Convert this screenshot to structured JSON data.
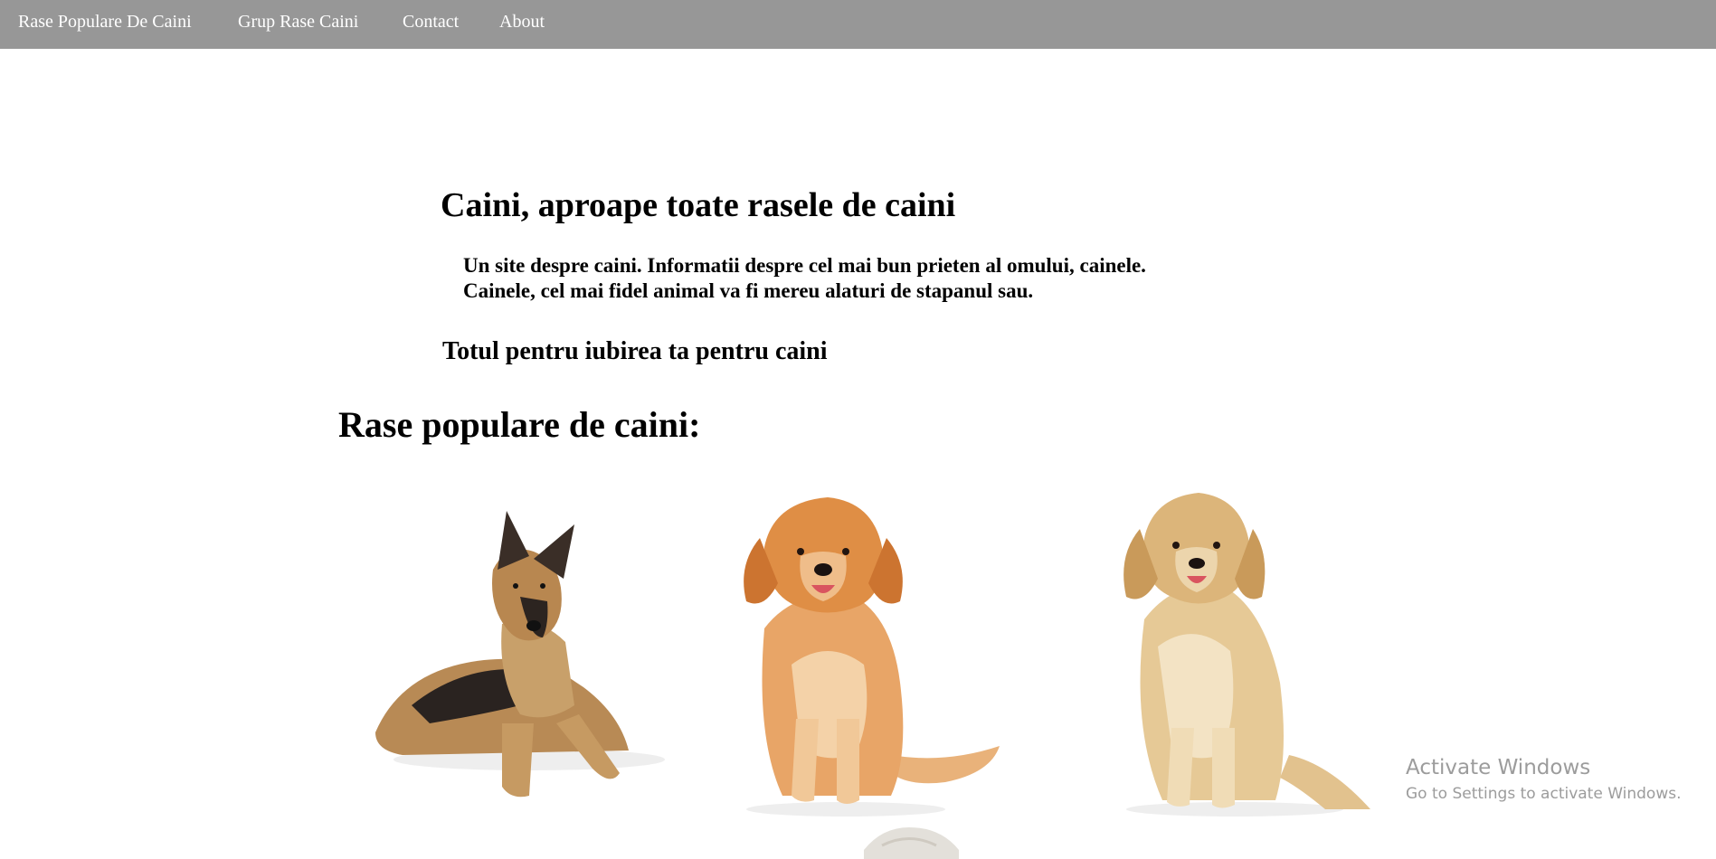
{
  "nav": {
    "links": [
      {
        "label": "Rase Populare De Caini"
      },
      {
        "label": "Grup Rase Caini"
      },
      {
        "label": "Contact"
      },
      {
        "label": "About"
      }
    ],
    "background": "#979797"
  },
  "main": {
    "title": "Caini, aproape toate rasele de caini",
    "intro_line_1": "Un site despre caini. Informatii despre cel mai bun prieten al omului, cainele.",
    "intro_line_2": "Cainele, cel mai fidel animal va fi mereu alaturi de stapanul sau.",
    "tagline": "Totul pentru iubirea ta pentru caini",
    "section_title": "Rase populare de caini:"
  },
  "dogs": [
    {
      "icon": "german-shepherd-photo"
    },
    {
      "icon": "golden-retriever-red-photo"
    },
    {
      "icon": "golden-retriever-light-photo"
    },
    {
      "icon": "dog-photo-partial"
    }
  ],
  "watermark": {
    "title": "Activate Windows",
    "subtitle": "Go to Settings to activate Windows."
  }
}
